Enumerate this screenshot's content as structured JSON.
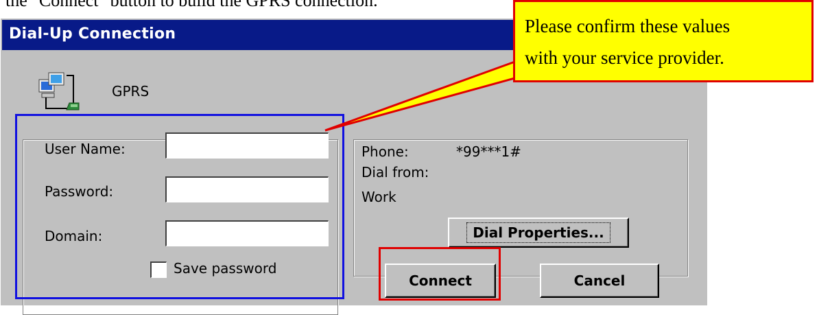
{
  "document": {
    "intro_text": "the \"Connect\" button to build the GPRS connection."
  },
  "dialog": {
    "title": "Dial-Up Connection",
    "connection_name": "GPRS",
    "icon": "network-computers-icon",
    "login": {
      "user_name_label": "User Name:",
      "password_label": "Password:",
      "domain_label": "Domain:",
      "user_name_value": "",
      "password_value": "",
      "domain_value": "",
      "save_password_label": "Save password",
      "save_password_checked": false
    },
    "dial_info": {
      "phone_label": "Phone:",
      "phone_value": "*99***1#",
      "dial_from_label": "Dial from:",
      "location": "Work",
      "dial_properties_label": "Dial Properties..."
    },
    "buttons": {
      "connect_label": "Connect",
      "cancel_label": "Cancel"
    }
  },
  "annotation": {
    "callout_lines": [
      "Please confirm these values",
      "with your service provider."
    ],
    "colors": {
      "callout_fill": "#ffff00",
      "callout_border": "#e00000",
      "highlight_login": "#1010e0",
      "highlight_connect": "#e00000"
    }
  }
}
